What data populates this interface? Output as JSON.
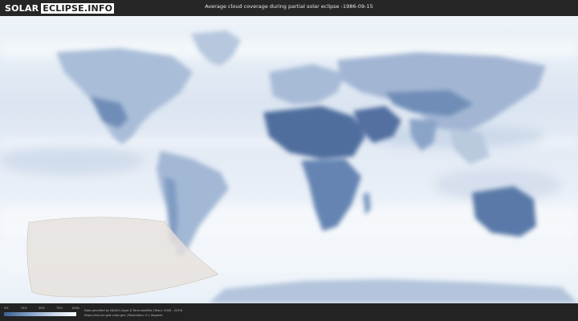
{
  "header": {
    "logo_part1": "SOLAR",
    "logo_part2": "ECLIPSE.INFO",
    "title": "Average cloud coverage during partial solar eclipse -1986-09-15"
  },
  "legend": {
    "ticks": [
      "0%",
      "25%",
      "50%",
      "75%",
      "100%"
    ],
    "colors": [
      "#3d5f8e",
      "#7e9ec4",
      "#c5d5e8",
      "#ffffff"
    ]
  },
  "credits": {
    "line1": "Data provided by NASA's Aqua & Terra satellite (Years: 2000 - 2019)",
    "line2": "https://neo.sci.gsfc.nasa.gov | Resolution: 0.1 degrees"
  },
  "colors": {
    "ocean": "#dfe8f3",
    "cloud_dense": "#f4f7fb",
    "land_clear": "#5d7ca9",
    "eclipse_zone": "#e6e1dc"
  }
}
